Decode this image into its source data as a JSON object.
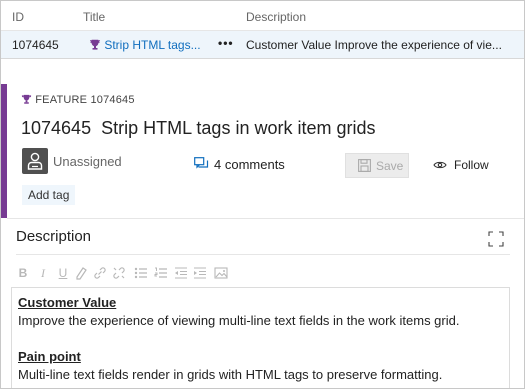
{
  "grid": {
    "headers": {
      "id": "ID",
      "title": "Title",
      "description": "Description"
    },
    "row": {
      "id": "1074645",
      "title": "Strip HTML tags...",
      "more": "•••",
      "description": "Customer Value Improve the experience of vie..."
    }
  },
  "work_item": {
    "type_label": "FEATURE 1074645",
    "id": "1074645",
    "title": "Strip HTML tags in work item grids",
    "assignee": "Unassigned",
    "comments": "4 comments",
    "save_label": "Save",
    "follow_label": "Follow",
    "add_tag_label": "Add tag",
    "accent_color": "#773b93"
  },
  "description": {
    "heading": "Description",
    "toolbar_icons": [
      "bold-icon",
      "italic-icon",
      "underline-icon",
      "highlight-icon",
      "link-icon",
      "unlink-icon",
      "bullet-list-icon",
      "numbered-list-icon",
      "outdent-icon",
      "indent-icon",
      "image-icon"
    ],
    "content": {
      "h1": "Customer Value",
      "p1": "Improve the experience of viewing multi-line text fields in the work items grid.",
      "h2": "Pain point",
      "p2": "Multi-line text fields render in grids with HTML tags to preserve formatting."
    }
  }
}
